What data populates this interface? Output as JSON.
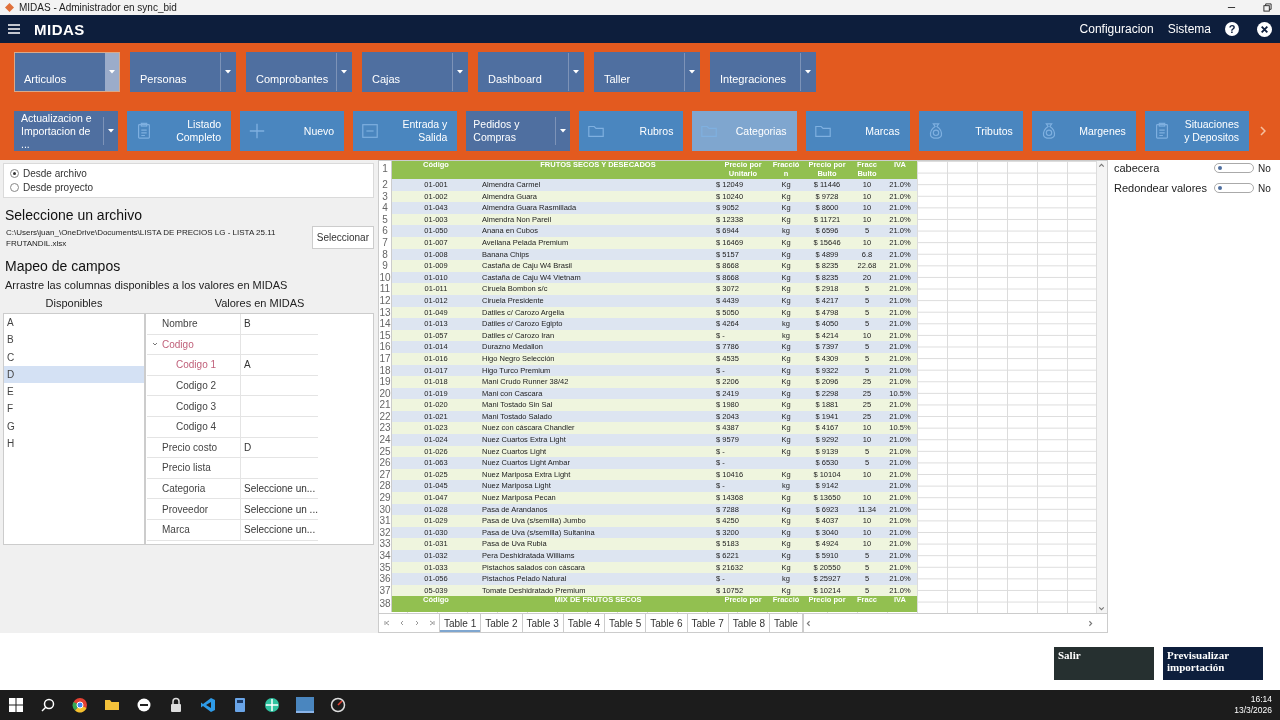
{
  "window": {
    "title": "MIDAS - Administrador en sync_bid"
  },
  "navbar": {
    "brand": "MIDAS",
    "links": [
      "Configuracion",
      "Sistema"
    ],
    "help": "?"
  },
  "modules": [
    {
      "label": "Articulos",
      "selected": true
    },
    {
      "label": "Personas",
      "selected": false
    },
    {
      "label": "Comprobantes",
      "selected": false
    },
    {
      "label": "Cajas",
      "selected": false
    },
    {
      "label": "Dashboard",
      "selected": false
    },
    {
      "label": "Taller",
      "selected": false
    },
    {
      "label": "Integraciones",
      "selected": false
    }
  ],
  "actions": [
    {
      "label": "Actualizacion e Importacion de ...",
      "kind": "dropdown",
      "selected": false
    },
    {
      "label": "Listado Completo",
      "kind": "clipboard",
      "selected": false
    },
    {
      "label": "Nuevo",
      "kind": "plus",
      "selected": false
    },
    {
      "label": "Entrada y Salida",
      "kind": "box",
      "selected": false
    },
    {
      "label": "Pedidos y Compras",
      "kind": "dropdown",
      "selected": false
    },
    {
      "label": "Rubros",
      "kind": "folder",
      "selected": false
    },
    {
      "label": "Categorias",
      "kind": "folder",
      "selected": true
    },
    {
      "label": "Marcas",
      "kind": "folder",
      "selected": false
    },
    {
      "label": "Tributos",
      "kind": "bag",
      "selected": false
    },
    {
      "label": "Margenes",
      "kind": "bag",
      "selected": false
    },
    {
      "label": "Situaciones y Depositos",
      "kind": "clipboard",
      "selected": false
    }
  ],
  "source": {
    "options": [
      {
        "label": "Desde archivo",
        "selected": true
      },
      {
        "label": "Desde proyecto",
        "selected": false
      }
    ]
  },
  "file": {
    "heading": "Seleccione un archivo",
    "path": "C:\\Users\\juan_\\OneDrive\\Documents\\LISTA DE PRECIOS LG - LISTA 25.11 FRUTANDIL.xlsx",
    "button": "Seleccionar"
  },
  "mapping": {
    "heading": "Mapeo de campos",
    "hint": "Arrastre las columnas disponibles a los valores en MIDAS",
    "available_header": "Disponibles",
    "values_header": "Valores en MIDAS",
    "available": [
      {
        "label": "A",
        "selected": false
      },
      {
        "label": "B",
        "selected": false
      },
      {
        "label": "C",
        "selected": false
      },
      {
        "label": "D",
        "selected": true
      },
      {
        "label": "E",
        "selected": false
      },
      {
        "label": "F",
        "selected": false
      },
      {
        "label": "G",
        "selected": false
      },
      {
        "label": "H",
        "selected": false
      }
    ],
    "fields": [
      {
        "label": "Nombre",
        "value": "B",
        "highlighted": false
      },
      {
        "label": "Codigo",
        "highlighted": true,
        "expanded": true,
        "children": [
          {
            "label": "Codigo 1",
            "value": "A",
            "highlighted": true
          },
          {
            "label": "Codigo 2",
            "highlighted": false
          },
          {
            "label": "Codigo 3",
            "highlighted": false
          },
          {
            "label": "Codigo 4",
            "highlighted": false
          }
        ]
      },
      {
        "label": "Precio costo",
        "value": "D",
        "highlighted": false
      },
      {
        "label": "Precio lista",
        "highlighted": false
      },
      {
        "label": "Categoria",
        "value": "Seleccione un...",
        "highlighted": false
      },
      {
        "label": "Proveedor",
        "value": "Seleccione un ...",
        "highlighted": false
      },
      {
        "label": "Marca",
        "value": "Seleccione un...",
        "highlighted": false
      }
    ]
  },
  "sheet": {
    "header": {
      "n": "1",
      "cells": [
        "Código",
        "FRUTOS SECOS Y DESECADOS",
        "Precio por Unitario",
        "Fracció n",
        "Precio por Bulto",
        "Fracc Bulto",
        "IVA"
      ]
    },
    "rows": [
      {
        "n": "2",
        "code": "01-001",
        "name": "Almendra Carmel",
        "price": "$ 12049",
        "unit": "Kg",
        "bulk_price": "$ 11446",
        "bulk_qty": "10",
        "iva": "21.0%"
      },
      {
        "n": "3",
        "code": "01-002",
        "name": "Almendra Guara",
        "price": "$ 10240",
        "unit": "Kg",
        "bulk_price": "$ 9728",
        "bulk_qty": "10",
        "iva": "21.0%"
      },
      {
        "n": "4",
        "code": "01-043",
        "name": "Almendra Guara Rasmillada",
        "price": "$ 9052",
        "unit": "Kg",
        "bulk_price": "$ 8600",
        "bulk_qty": "10",
        "iva": "21.0%"
      },
      {
        "n": "5",
        "code": "01-003",
        "name": "Almendra Non Pareil",
        "price": "$ 12338",
        "unit": "Kg",
        "bulk_price": "$ 11721",
        "bulk_qty": "10",
        "iva": "21.0%"
      },
      {
        "n": "6",
        "code": "01-050",
        "name": "Anana en Cubos",
        "price": "$ 6944",
        "unit": "kg",
        "bulk_price": "$ 6596",
        "bulk_qty": "5",
        "iva": "21.0%"
      },
      {
        "n": "7",
        "code": "01-007",
        "name": "Avellana Pelada Premium",
        "price": "$ 16469",
        "unit": "Kg",
        "bulk_price": "$ 15646",
        "bulk_qty": "10",
        "iva": "21.0%"
      },
      {
        "n": "8",
        "code": "01-008",
        "name": "Banana Chips",
        "price": "$ 5157",
        "unit": "Kg",
        "bulk_price": "$ 4899",
        "bulk_qty": "6.8",
        "iva": "21.0%"
      },
      {
        "n": "9",
        "code": "01-009",
        "name": "Castaña de Caju W4 Brasil",
        "price": "$ 8668",
        "unit": "Kg",
        "bulk_price": "$ 8235",
        "bulk_qty": "22.68",
        "iva": "21.0%"
      },
      {
        "n": "10",
        "code": "01-010",
        "name": "Castaña de Caju W4 Vietnam",
        "price": "$ 8668",
        "unit": "Kg",
        "bulk_price": "$ 8235",
        "bulk_qty": "20",
        "iva": "21.0%"
      },
      {
        "n": "11",
        "code": "01-011",
        "name": "Ciruela Bombon s/c",
        "price": "$ 3072",
        "unit": "Kg",
        "bulk_price": "$ 2918",
        "bulk_qty": "5",
        "iva": "21.0%"
      },
      {
        "n": "12",
        "code": "01-012",
        "name": "Ciruela Presidente",
        "price": "$ 4439",
        "unit": "Kg",
        "bulk_price": "$ 4217",
        "bulk_qty": "5",
        "iva": "21.0%"
      },
      {
        "n": "13",
        "code": "01-049",
        "name": "Datiles c/ Carozo Argelia",
        "price": "$ 5050",
        "unit": "Kg",
        "bulk_price": "$ 4798",
        "bulk_qty": "5",
        "iva": "21.0%"
      },
      {
        "n": "14",
        "code": "01-013",
        "name": "Datiles c/ Carozo Egipto",
        "price": "$ 4264",
        "unit": "kg",
        "bulk_price": "$ 4050",
        "bulk_qty": "5",
        "iva": "21.0%"
      },
      {
        "n": "15",
        "code": "01-057",
        "name": "Datiles c/ Carozo Iran",
        "price": "$ -",
        "unit": "kg",
        "bulk_price": "$ 4214",
        "bulk_qty": "10",
        "iva": "21.0%"
      },
      {
        "n": "16",
        "code": "01-014",
        "name": "Durazno Medallon",
        "price": "$ 7786",
        "unit": "Kg",
        "bulk_price": "$ 7397",
        "bulk_qty": "5",
        "iva": "21.0%"
      },
      {
        "n": "17",
        "code": "01-016",
        "name": "Higo Negro Selección",
        "price": "$ 4535",
        "unit": "Kg",
        "bulk_price": "$ 4309",
        "bulk_qty": "5",
        "iva": "21.0%"
      },
      {
        "n": "18",
        "code": "01-017",
        "name": "Higo Turco Premium",
        "price": "$ -",
        "unit": "Kg",
        "bulk_price": "$ 9322",
        "bulk_qty": "5",
        "iva": "21.0%"
      },
      {
        "n": "19",
        "code": "01-018",
        "name": "Mani Crudo Runner 38/42",
        "price": "$ 2206",
        "unit": "Kg",
        "bulk_price": "$ 2096",
        "bulk_qty": "25",
        "iva": "21.0%"
      },
      {
        "n": "20",
        "code": "01-019",
        "name": "Mani con Cascara",
        "price": "$ 2419",
        "unit": "Kg",
        "bulk_price": "$ 2298",
        "bulk_qty": "25",
        "iva": "10.5%"
      },
      {
        "n": "21",
        "code": "01-020",
        "name": "Mani Tostado Sin Sal",
        "price": "$ 1980",
        "unit": "Kg",
        "bulk_price": "$ 1881",
        "bulk_qty": "25",
        "iva": "21.0%"
      },
      {
        "n": "22",
        "code": "01-021",
        "name": "Mani Tostado Salado",
        "price": "$ 2043",
        "unit": "Kg",
        "bulk_price": "$ 1941",
        "bulk_qty": "25",
        "iva": "21.0%"
      },
      {
        "n": "23",
        "code": "01-023",
        "name": "Nuez con cáscara Chandler",
        "price": "$ 4387",
        "unit": "Kg",
        "bulk_price": "$ 4167",
        "bulk_qty": "10",
        "iva": "10.5%"
      },
      {
        "n": "24",
        "code": "01-024",
        "name": "Nuez Cuartos Extra Light",
        "price": "$ 9579",
        "unit": "Kg",
        "bulk_price": "$ 9292",
        "bulk_qty": "10",
        "iva": "21.0%"
      },
      {
        "n": "25",
        "code": "01-026",
        "name": "Nuez Cuartos Light",
        "price": "$ -",
        "unit": "Kg",
        "bulk_price": "$ 9139",
        "bulk_qty": "5",
        "iva": "21.0%"
      },
      {
        "n": "26",
        "code": "01-063",
        "name": "Nuez Cuartos Light Ambar",
        "price": "$ -",
        "bulk_price": "$ 6530",
        "bulk_qty": "5",
        "iva": "21.0%"
      },
      {
        "n": "27",
        "code": "01-025",
        "name": "Nuez Mariposa Extra Light",
        "price": "$ 10416",
        "unit": "Kg",
        "bulk_price": "$ 10104",
        "bulk_qty": "10",
        "iva": "21.0%"
      },
      {
        "n": "28",
        "code": "01-045",
        "name": "Nuez Mariposa Light",
        "price": "$ -",
        "unit": "kg",
        "bulk_price": "$ 9142",
        "iva": "21.0%"
      },
      {
        "n": "29",
        "code": "01-047",
        "name": "Nuez Mariposa Pecan",
        "price": "$ 14368",
        "unit": "Kg",
        "bulk_price": "$ 13650",
        "bulk_qty": "10",
        "iva": "21.0%"
      },
      {
        "n": "30",
        "code": "01-028",
        "name": "Pasa de Arandanos",
        "price": "$ 7288",
        "unit": "Kg",
        "bulk_price": "$ 6923",
        "bulk_qty": "11.34",
        "iva": "21.0%"
      },
      {
        "n": "31",
        "code": "01-029",
        "name": "Pasa de Uva (s/semilla) Jumbo",
        "price": "$ 4250",
        "unit": "Kg",
        "bulk_price": "$ 4037",
        "bulk_qty": "10",
        "iva": "21.0%"
      },
      {
        "n": "32",
        "code": "01-030",
        "name": "Pasa de Uva (s/semilla) Sultanina",
        "price": "$ 3200",
        "unit": "Kg",
        "bulk_price": "$ 3040",
        "bulk_qty": "10",
        "iva": "21.0%"
      },
      {
        "n": "33",
        "code": "01-031",
        "name": "Pasa de Uva Rubia",
        "price": "$ 5183",
        "unit": "Kg",
        "bulk_price": "$ 4924",
        "bulk_qty": "10",
        "iva": "21.0%"
      },
      {
        "n": "34",
        "code": "01-032",
        "name": "Pera Deshidratada Williams",
        "price": "$ 6221",
        "unit": "Kg",
        "bulk_price": "$ 5910",
        "bulk_qty": "5",
        "iva": "21.0%"
      },
      {
        "n": "35",
        "code": "01-033",
        "name": "Pistachos salados con cáscara",
        "price": "$ 21632",
        "unit": "Kg",
        "bulk_price": "$ 20550",
        "bulk_qty": "5",
        "iva": "21.0%"
      },
      {
        "n": "36",
        "code": "01-056",
        "name": "Pistachos Pelado Natural",
        "price": "$ -",
        "unit": "kg",
        "bulk_price": "$ 25927",
        "bulk_qty": "5",
        "iva": "21.0%"
      },
      {
        "n": "37",
        "code": "05-039",
        "name": "Tomate Deshidratado Premium",
        "price": "$ 10752",
        "unit": "Kg",
        "bulk_price": "$ 10214",
        "bulk_qty": "5",
        "iva": "21.0%"
      }
    ],
    "section_header": {
      "n": "38",
      "cells": [
        "Código",
        "MIX DE FRUTOS SECOS",
        "Precio por",
        "Fracció",
        "Precio por",
        "Fracc",
        "IVA"
      ]
    },
    "tabs": [
      {
        "label": "Table 1",
        "selected": true
      },
      {
        "label": "Table 2",
        "selected": false
      },
      {
        "label": "Table 3",
        "selected": false
      },
      {
        "label": "Table 4",
        "selected": false
      },
      {
        "label": "Table 5",
        "selected": false
      },
      {
        "label": "Table 6",
        "selected": false
      },
      {
        "label": "Table 7",
        "selected": false
      },
      {
        "label": "Table 8",
        "selected": false
      },
      {
        "label": "Table",
        "selected": false
      }
    ]
  },
  "options": [
    {
      "label": "cabecera",
      "on": false,
      "state": "No"
    },
    {
      "label": "Redondear valores",
      "on": false,
      "state": "No"
    }
  ],
  "buttons": [
    {
      "label": "Salir",
      "kind": "secondary"
    },
    {
      "label": "Previsualizar importación",
      "kind": "primary"
    }
  ],
  "taskbar": {
    "time": "16:14",
    "date": "13/3/2026"
  }
}
